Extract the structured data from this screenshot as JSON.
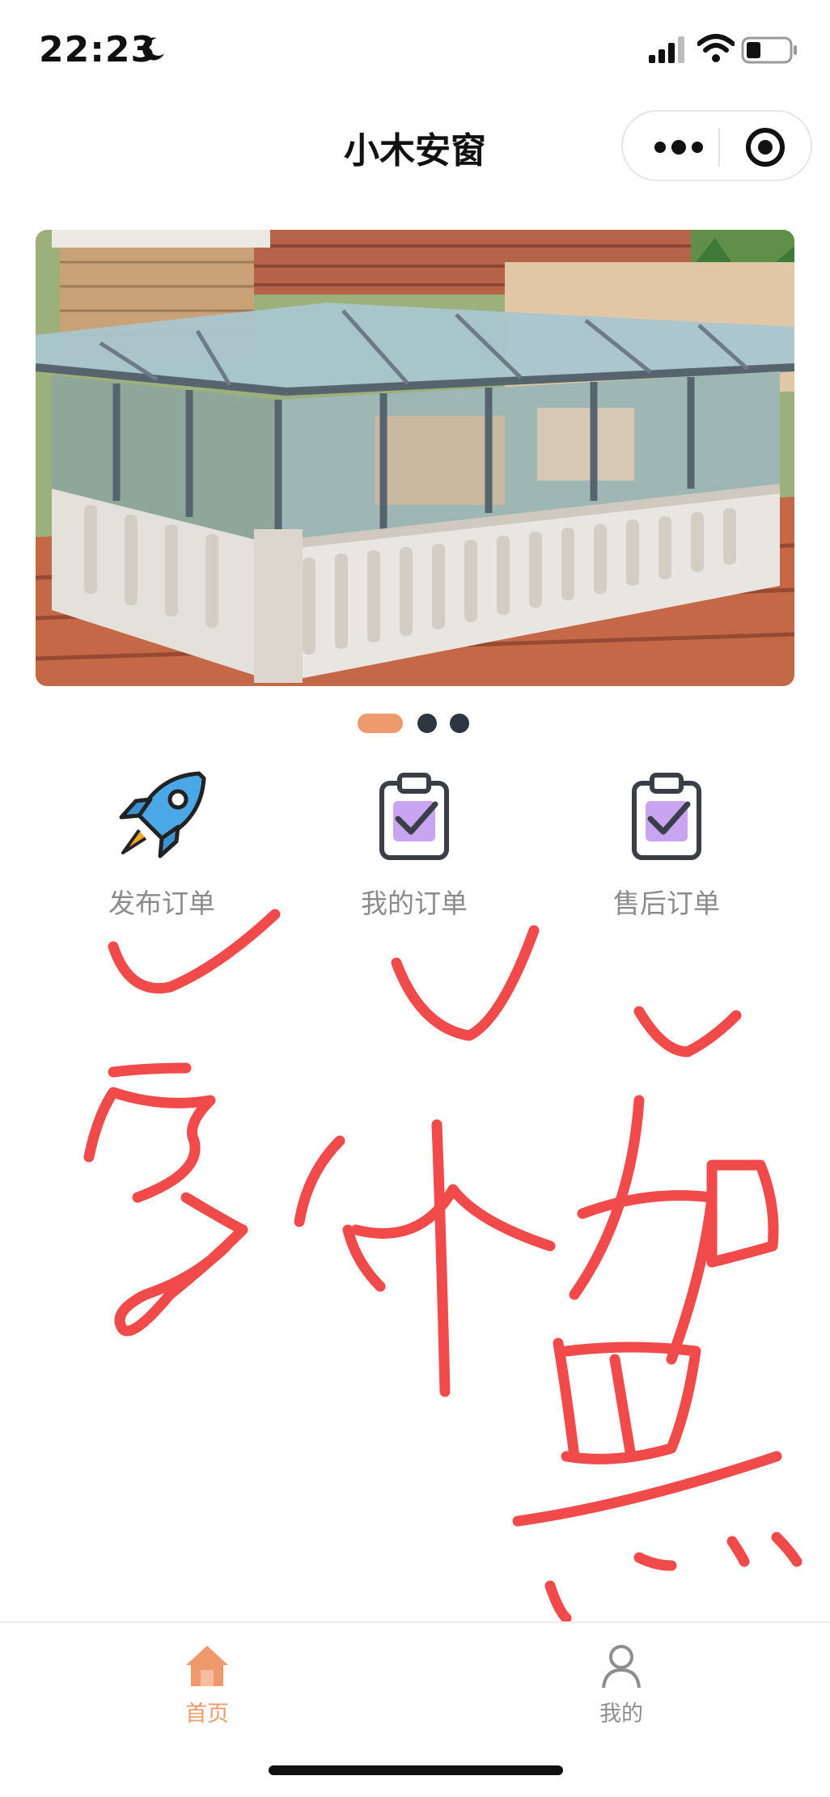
{
  "status_bar": {
    "time": "22:23",
    "icons": [
      "moon-icon",
      "signal-icon",
      "wifi-icon",
      "battery-icon"
    ]
  },
  "header": {
    "title": "小木安窗",
    "icons": [
      "more-icon",
      "target-icon"
    ]
  },
  "banner": {
    "image": "glass-sunroom-photo",
    "slide_count": 3,
    "active_slide": 1
  },
  "entries": [
    {
      "label": "发布订单",
      "icon": "rocket-icon"
    },
    {
      "label": "我的订单",
      "icon": "clipboard-check-icon"
    },
    {
      "label": "售后订单",
      "icon": "clipboard-check-icon"
    }
  ],
  "annotation": {
    "text": "字体加黑",
    "color": "#f04a4a"
  },
  "tabbar": {
    "tabs": [
      {
        "label": "首页",
        "icon": "home-icon",
        "active": true
      },
      {
        "label": "我的",
        "icon": "user-icon",
        "active": false
      }
    ],
    "active_color": "#ef9a6c",
    "inactive_color": "#8e8e8e"
  },
  "colors": {
    "accent": "#ef9a6c",
    "dot_inactive": "#2e3642",
    "label_gray": "#8a8a8a"
  }
}
